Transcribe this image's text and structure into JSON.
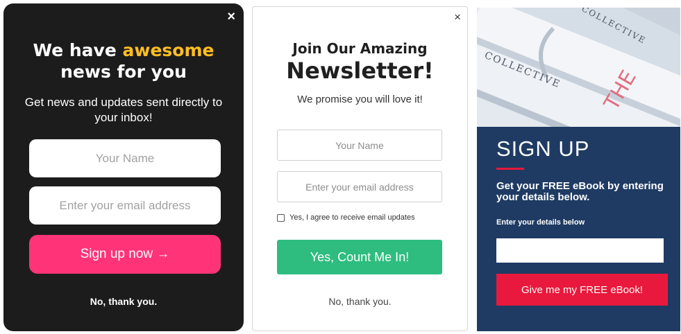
{
  "popup1": {
    "close": "×",
    "headline_pre": "We have ",
    "headline_highlight": "awesome",
    "headline_post": "news for you",
    "subtitle": "Get news and updates sent directly to your inbox!",
    "name_placeholder": "Your Name",
    "email_placeholder": "Enter your email address",
    "button": "Sign up now →",
    "decline": "No, thank you.",
    "colors": {
      "background": "#1d1c1c",
      "highlight": "#fbbd24",
      "button": "#ff3478"
    }
  },
  "popup2": {
    "close": "×",
    "title_line1": "Join Our Amazing",
    "title_line2": "Newsletter!",
    "subtitle": "We promise you will love it!",
    "name_placeholder": "Your Name",
    "email_placeholder": "Enter your email address",
    "consent": "Yes, I agree to receive email updates",
    "button": "Yes, Count Me In!",
    "decline": "No, thank you.",
    "colors": {
      "button": "#2ebd7f"
    }
  },
  "popup3": {
    "title": "SIGN UP",
    "lead": "Get your FREE eBook by entering your details below.",
    "label": "Enter your details below",
    "button": "Give me my FREE eBook!",
    "photo_text_1": "COLLECTIVE",
    "photo_text_2": "THE",
    "photo_text_3": "COLLECTIVE",
    "colors": {
      "panel": "#1f3b63",
      "accent": "#e8193c"
    }
  }
}
